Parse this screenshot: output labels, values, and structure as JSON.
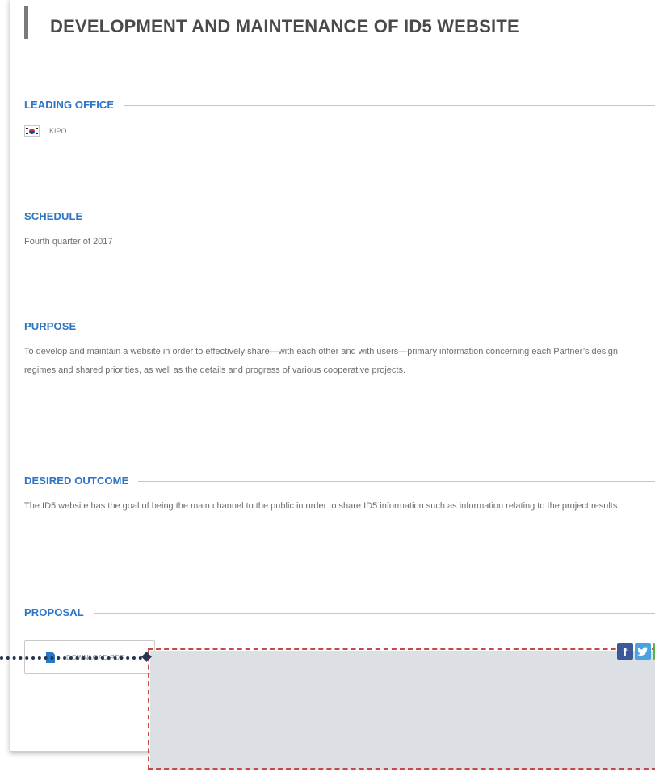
{
  "page": {
    "title": "DEVELOPMENT AND MAINTENANCE OF ID5 WEBSITE"
  },
  "sections": {
    "leading_office": {
      "heading": "LEADING OFFICE",
      "office": "KIPO",
      "flag_icon": "south-korea-flag-icon"
    },
    "schedule": {
      "heading": "SCHEDULE",
      "text": "Fourth quarter of 2017"
    },
    "purpose": {
      "heading": "PURPOSE",
      "text": "To develop and maintain a website in order to effectively share—with each other and with users—primary information concerning each Partner’s design regimes and shared priorities, as well as the details and progress of various cooperative projects."
    },
    "desired_outcome": {
      "heading": "DESIRED OUTCOME",
      "text": "The ID5 website has the goal of being the main channel to the public in order to share ID5 information such as information relating to the project results."
    },
    "proposal": {
      "heading": "PROPOSAL",
      "download_label": "DOWNLOAD PDF",
      "download_icon": "document-icon"
    }
  },
  "footer": {
    "social": [
      {
        "icon": "facebook-icon",
        "glyph": "f"
      },
      {
        "icon": "twitter-icon",
        "glyph": "t"
      },
      {
        "icon": "wechat-icon",
        "glyph": ""
      }
    ]
  },
  "colors": {
    "heading_blue": "#2c74c4",
    "title_gray": "#4a4a4a",
    "footer_bg": "#dcdfe4",
    "highlight_red": "#c44a4a",
    "connector_navy": "#27364c"
  }
}
